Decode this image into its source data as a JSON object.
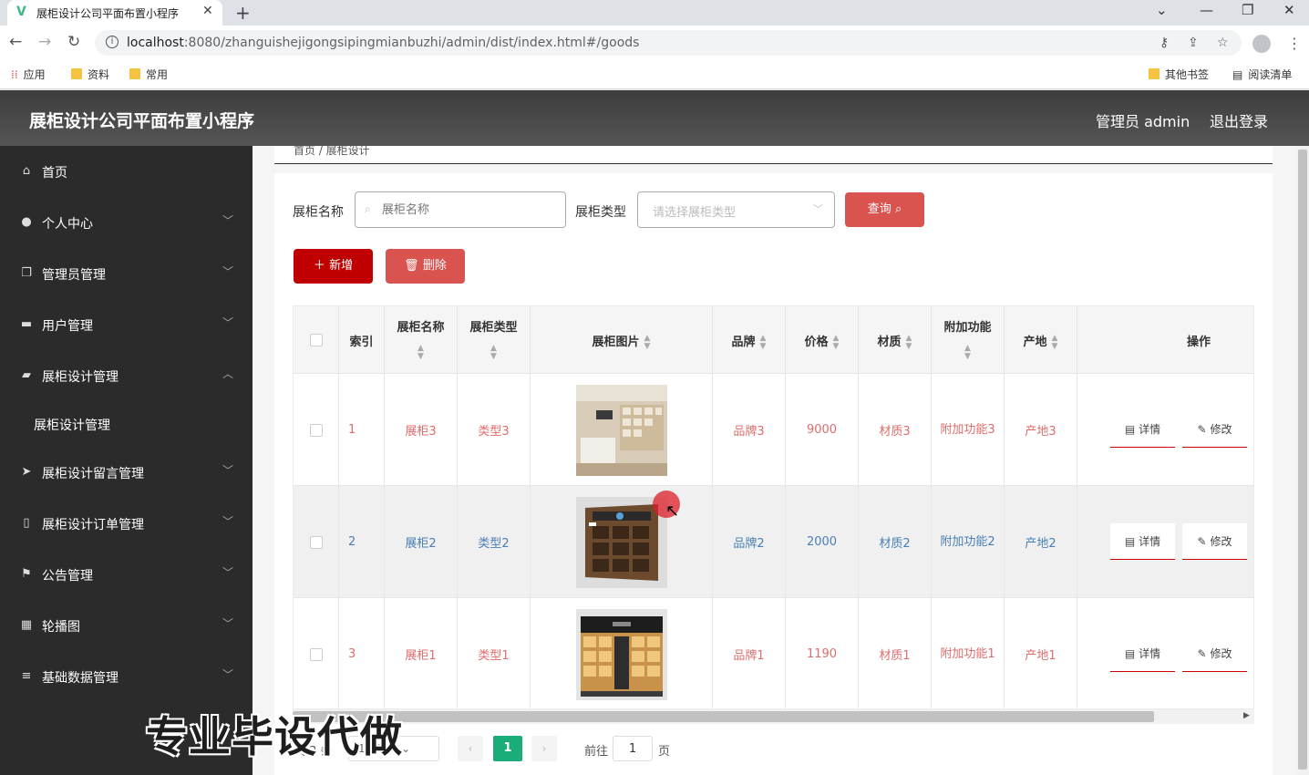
{
  "browser": {
    "tab_title": "展柜设计公司平面布置小程序",
    "url_host": "localhost",
    "url_rest": ":8080/zhanguishejigongsipingmianbuzhi/admin/dist/index.html#/goods",
    "bookmarks": [
      "应用",
      "资料",
      "常用"
    ],
    "bookmarks_right": [
      "其他书签",
      "阅读清单"
    ]
  },
  "header": {
    "title": "展柜设计公司平面布置小程序",
    "admin": "管理员 admin",
    "logout": "退出登录"
  },
  "sidebar": {
    "items": [
      {
        "label": "首页",
        "icon": "home-icon"
      },
      {
        "label": "个人中心",
        "icon": "user-icon"
      },
      {
        "label": "管理员管理",
        "icon": "copy-icon"
      },
      {
        "label": "用户管理",
        "icon": "monitor-icon"
      },
      {
        "label": "展柜设计管理",
        "icon": "briefcase-icon"
      },
      {
        "label": "展柜设计管理",
        "icon": ""
      },
      {
        "label": "展柜设计留言管理",
        "icon": "send-icon"
      },
      {
        "label": "展柜设计订单管理",
        "icon": "phone-icon"
      },
      {
        "label": "公告管理",
        "icon": "flag-icon"
      },
      {
        "label": "轮播图",
        "icon": "grid-icon"
      },
      {
        "label": "基础数据管理",
        "icon": "list-icon"
      }
    ]
  },
  "breadcrumb": "首页 / 展柜设计",
  "search": {
    "name_label": "展柜名称",
    "name_placeholder": "展柜名称",
    "type_label": "展柜类型",
    "type_placeholder": "请选择展柜类型",
    "query_button": "查询"
  },
  "actions": {
    "add": "新增",
    "delete": "删除"
  },
  "table": {
    "headers": {
      "index": "索引",
      "name": "展柜名称",
      "type": "展柜类型",
      "image": "展柜图片",
      "brand": "品牌",
      "price": "价格",
      "material": "材质",
      "feature": "附加功能",
      "origin": "产地",
      "ops": "操作"
    },
    "rows": [
      {
        "index": "1",
        "name": "展柜3",
        "type": "类型3",
        "brand": "品牌3",
        "price": "9000",
        "material": "材质3",
        "feature": "附加功能3",
        "origin": "产地3",
        "detail": "详情",
        "edit": "修改",
        "color": "#e06c6c"
      },
      {
        "index": "2",
        "name": "展柜2",
        "type": "类型2",
        "brand": "品牌2",
        "price": "2000",
        "material": "材质2",
        "feature": "附加功能2",
        "origin": "产地2",
        "detail": "详情",
        "edit": "修改",
        "color": "#4a7fb5"
      },
      {
        "index": "3",
        "name": "展柜1",
        "type": "类型1",
        "brand": "品牌1",
        "price": "1190",
        "material": "材质1",
        "feature": "附加功能1",
        "origin": "产地1",
        "detail": "详情",
        "edit": "修改",
        "color": "#e06c6c"
      }
    ]
  },
  "pagination": {
    "total": "共 3 条",
    "page_size": "10条/页",
    "current": "1",
    "goto_label": "前往",
    "goto_value": "1",
    "suffix": "页"
  },
  "watermark": "专业毕设代做",
  "colors": {
    "accent_red": "#c00000",
    "query_red": "#d9534f",
    "page_green": "#1aad7a",
    "sidebar_bg": "#2b2b2b"
  }
}
